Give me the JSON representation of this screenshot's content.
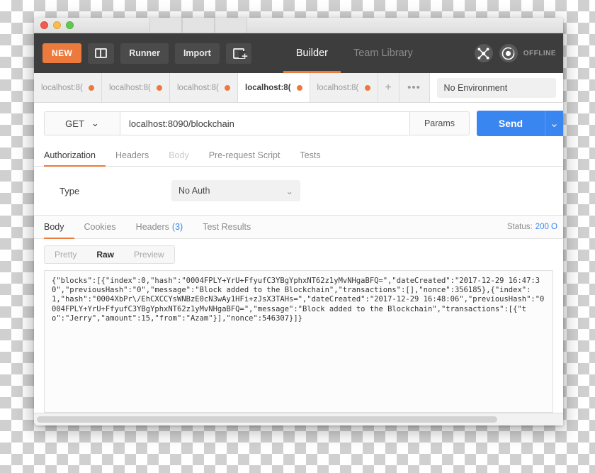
{
  "window": {
    "traffic_lights": [
      "close",
      "minimize",
      "zoom"
    ]
  },
  "header": {
    "new_label": "NEW",
    "sidebar_toggle_name": "sidebar-toggle",
    "runner_label": "Runner",
    "import_label": "Import",
    "new_tab_name": "new-window-button",
    "tabs": [
      {
        "label": "Builder",
        "active": true
      },
      {
        "label": "Team Library",
        "active": false
      }
    ],
    "sync_icon": "network-icon",
    "account_icon": "account-icon",
    "offline_label": "OFFLINE"
  },
  "request_tabs": {
    "items": [
      {
        "label": "localhost:8(",
        "active": false,
        "dirty": true
      },
      {
        "label": "localhost:8(",
        "active": false,
        "dirty": true
      },
      {
        "label": "localhost:8(",
        "active": false,
        "dirty": true
      },
      {
        "label": "localhost:8(",
        "active": true,
        "dirty": true
      },
      {
        "label": "localhost:8(",
        "active": false,
        "dirty": true
      }
    ],
    "add_label": "+",
    "more_label": "•••"
  },
  "environment": {
    "selected": "No Environment"
  },
  "url_bar": {
    "method": "GET",
    "method_caret": "⌄",
    "url": "localhost:8090/blockchain",
    "params_label": "Params",
    "send_label": "Send",
    "send_caret": "⌄"
  },
  "request_tabs_sub": [
    {
      "label": "Authorization",
      "active": true,
      "disabled": false
    },
    {
      "label": "Headers",
      "active": false,
      "disabled": false
    },
    {
      "label": "Body",
      "active": false,
      "disabled": true
    },
    {
      "label": "Pre-request Script",
      "active": false,
      "disabled": false
    },
    {
      "label": "Tests",
      "active": false,
      "disabled": false
    }
  ],
  "auth": {
    "type_label": "Type",
    "type_value": "No Auth",
    "caret": "⌄"
  },
  "response_tabs": [
    {
      "label": "Body",
      "active": true,
      "count": ""
    },
    {
      "label": "Cookies",
      "active": false,
      "count": ""
    },
    {
      "label": "Headers",
      "active": false,
      "count": "(3)"
    },
    {
      "label": "Test Results",
      "active": false,
      "count": ""
    }
  ],
  "response_status": {
    "label": "Status:",
    "code": "200 O"
  },
  "format_tabs": [
    {
      "label": "Pretty",
      "active": false
    },
    {
      "label": "Raw",
      "active": true
    },
    {
      "label": "Preview",
      "active": false
    }
  ],
  "response_body": "{\"blocks\":[{\"index\":0,\"hash\":\"0004FPLY+YrU+FfyufC3YBgYphxNT62z1yMvNHgaBFQ=\",\"dateCreated\":\"2017-12-29 16:47:30\",\"previousHash\":\"0\",\"message\":\"Block added to the Blockchain\",\"transactions\":[],\"nonce\":356185},{\"index\":1,\"hash\":\"0004XbPr\\/EhCXCCYsWNBzE0cN3wAy1HFi+zJsX3TAHs=\",\"dateCreated\":\"2017-12-29 16:48:06\",\"previousHash\":\"0004FPLY+YrU+FfyufC3YBgYphxNT62z1yMvNHgaBFQ=\",\"message\":\"Block added to the Blockchain\",\"transactions\":[{\"to\":\"Jerry\",\"amount\":15,\"from\":\"Azam\"}],\"nonce\":546307}]}",
  "colors": {
    "accent_orange": "#eb7a3c",
    "send_blue": "#3a86f0",
    "header_dark": "#3d3d3d"
  }
}
